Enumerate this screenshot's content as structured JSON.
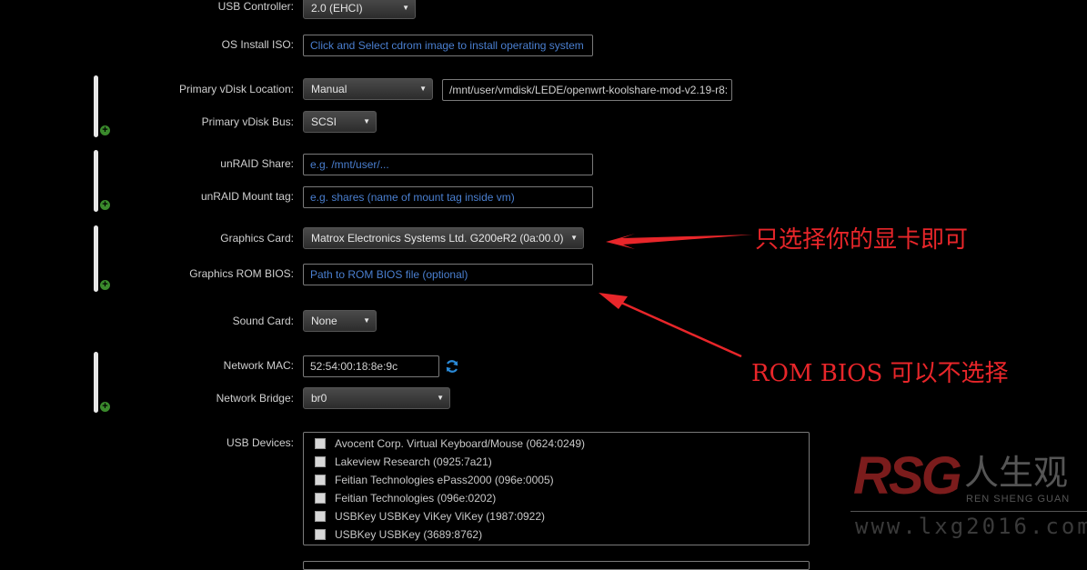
{
  "form": {
    "usb_controller": {
      "label": "USB Controller:",
      "value": "2.0 (EHCI)"
    },
    "os_install_iso": {
      "label": "OS Install ISO:",
      "placeholder": "Click and Select cdrom image to install operating system"
    },
    "primary_vdisk_location": {
      "label": "Primary vDisk Location:",
      "value": "Manual",
      "path": "/mnt/user/vmdisk/LEDE/openwrt-koolshare-mod-v2.19-r8:"
    },
    "primary_vdisk_bus": {
      "label": "Primary vDisk Bus:",
      "value": "SCSI"
    },
    "unraid_share": {
      "label": "unRAID Share:",
      "placeholder": "e.g. /mnt/user/..."
    },
    "unraid_mount_tag": {
      "label": "unRAID Mount tag:",
      "placeholder": "e.g. shares (name of mount tag inside vm)"
    },
    "graphics_card": {
      "label": "Graphics Card:",
      "value": "Matrox Electronics Systems Ltd. G200eR2 (0a:00.0)"
    },
    "graphics_rom_bios": {
      "label": "Graphics ROM BIOS:",
      "placeholder": "Path to ROM BIOS file (optional)"
    },
    "sound_card": {
      "label": "Sound Card:",
      "value": "None"
    },
    "network_mac": {
      "label": "Network MAC:",
      "value": "52:54:00:18:8e:9c"
    },
    "network_bridge": {
      "label": "Network Bridge:",
      "value": "br0"
    },
    "usb_devices": {
      "label": "USB Devices:",
      "items": [
        "Avocent Corp. Virtual Keyboard/Mouse (0624:0249)",
        "Lakeview Research (0925:7a21)",
        "Feitian Technologies ePass2000 (096e:0005)",
        "Feitian Technologies (096e:0202)",
        "USBKey USBKey ViKey ViKey (1987:0922)",
        "USBKey USBKey (3689:8762)"
      ]
    }
  },
  "annotations": {
    "graphics_note": "只选择你的显卡即可",
    "rom_note": "ROM BIOS 可以不选择"
  },
  "watermark": {
    "logo": "RSG",
    "cn": "人生观",
    "sub": "REN SHENG GUAN",
    "url": "www.lxg2016.com"
  },
  "icons": {
    "refresh": "refresh-icon",
    "add": "plus-circle-icon"
  },
  "colors": {
    "annotation": "#e8262a",
    "placeholder": "#4a7fd0",
    "add_icon": "#3a8a2c"
  }
}
